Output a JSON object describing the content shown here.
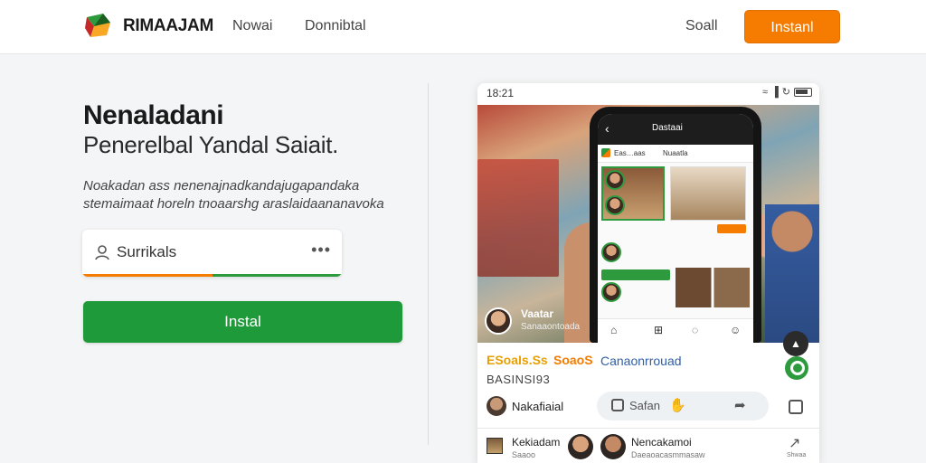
{
  "header": {
    "brand": "RIMAAJAM",
    "nav": [
      "Nowai",
      "Donnibtal"
    ],
    "signin": "Soall",
    "install_label": "Instanl"
  },
  "hero": {
    "headline": "Nenaladani",
    "subheadline": "Penerelbal Yandal Saiait.",
    "description": "Noakadan ass nenenajnadkandajugapandaka stemaimaat horeln tnoaarshg araslaidaananavoka",
    "search_placeholder": "Surrikals",
    "install_label": "Instal"
  },
  "device": {
    "time": "18:21",
    "status": "wifi signal",
    "phone_title": "Dastaai",
    "phone_bar_items": [
      "Eas…aas",
      "Nuaatla"
    ],
    "user_chip": {
      "name": "Vaatar",
      "sub": "Sanaaontoada"
    },
    "promo": [
      "ESoaIs.Ss",
      "SoaoS",
      "Canaonrrouad"
    ],
    "promo_sub": "BASINSI93",
    "post": {
      "name": "Nakafiaial",
      "pill_label": "Safan"
    },
    "feed": [
      {
        "name": "Kekiadam",
        "sub": "Saaoo"
      },
      {
        "name": "Nencakamoi",
        "sub": "Daeaoacasmmasaw"
      }
    ],
    "feed_share_label": "Shwaa"
  },
  "colors": {
    "accent_orange": "#f57c00",
    "accent_green": "#1f9a3a",
    "link_blue": "#2f5fa8"
  }
}
